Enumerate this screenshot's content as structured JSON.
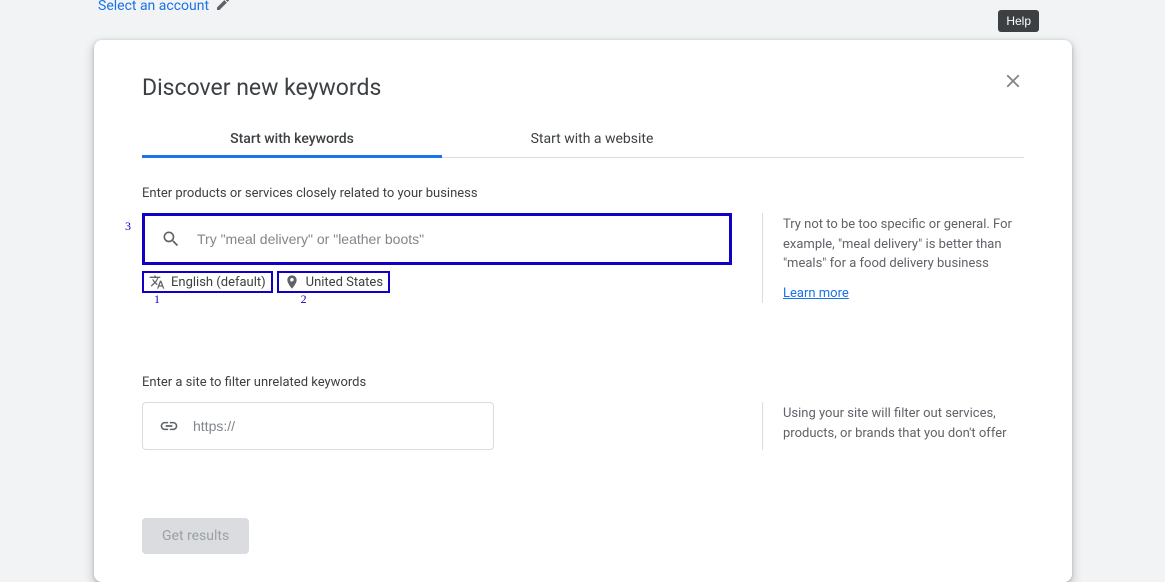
{
  "top": {
    "account_label": "Select an account"
  },
  "help_label": "Help",
  "modal": {
    "title": "Discover new keywords",
    "tabs": {
      "keywords": "Start with keywords",
      "website": "Start with a website"
    },
    "keywords_section": {
      "label": "Enter products or services closely related to your business",
      "placeholder": "Try \"meal delivery\" or \"leather boots\"",
      "tip": "Try not to be too specific or general. For example, \"meal delivery\" is better than \"meals\" for a food delivery business",
      "learn_more": "Learn more",
      "language": "English (default)",
      "location": "United States"
    },
    "site_section": {
      "label": "Enter a site to filter unrelated keywords",
      "placeholder": "https://",
      "tip": "Using your site will filter out services, products, or brands that you don't offer"
    },
    "results_button": "Get results",
    "annotations": {
      "ann1": "1",
      "ann2": "2",
      "ann3": "3"
    }
  }
}
